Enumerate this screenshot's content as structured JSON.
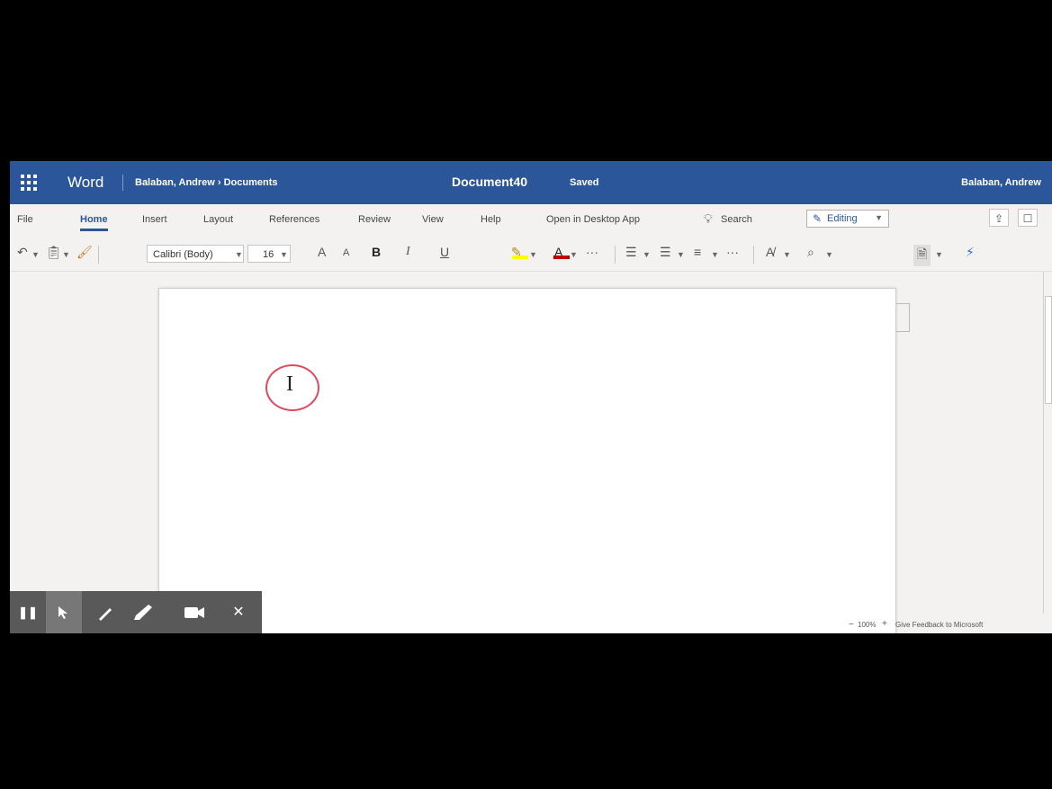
{
  "titlebar": {
    "app_name": "Word",
    "breadcrumb": "Balaban, Andrew › Documents",
    "document_title": "Document40",
    "save_state": "Saved",
    "user_name": "Balaban, Andrew",
    "color": "#2b579a"
  },
  "ribbon_tabs": [
    {
      "label": "File"
    },
    {
      "label": "Home",
      "active": true
    },
    {
      "label": "Insert"
    },
    {
      "label": "Layout"
    },
    {
      "label": "References"
    },
    {
      "label": "Review"
    },
    {
      "label": "View"
    },
    {
      "label": "Help"
    },
    {
      "label": "Open in Desktop App"
    }
  ],
  "search": {
    "label": "Search",
    "icon": "lightbulb-icon"
  },
  "mode": {
    "label": "Editing",
    "icon": "pencil-icon"
  },
  "toolbar": {
    "font_name": "Calibri (Body)",
    "font_size": "16",
    "grow_font": "A",
    "shrink_font": "A",
    "bold": "B",
    "italic": "I",
    "underline": "U",
    "more": "···",
    "highlight_color": "#ffff00",
    "font_color": "#c00000"
  },
  "statusbar": {
    "zoom_minus": "−",
    "zoom_value": "100%",
    "zoom_plus": "+",
    "feedback": "Give Feedback to Microsoft"
  },
  "cursor": {
    "glyph": "I",
    "ring_color": "#e04a5f"
  },
  "recorder": {
    "buttons": [
      {
        "name": "pause-icon",
        "glyph": "❚❚"
      },
      {
        "name": "pointer-icon",
        "glyph": "➤"
      },
      {
        "name": "pen-icon",
        "glyph": "╱"
      },
      {
        "name": "highlighter-icon",
        "glyph": "▰"
      },
      {
        "name": "camera-icon",
        "glyph": "■"
      },
      {
        "name": "close-icon",
        "glyph": "✕"
      }
    ]
  }
}
